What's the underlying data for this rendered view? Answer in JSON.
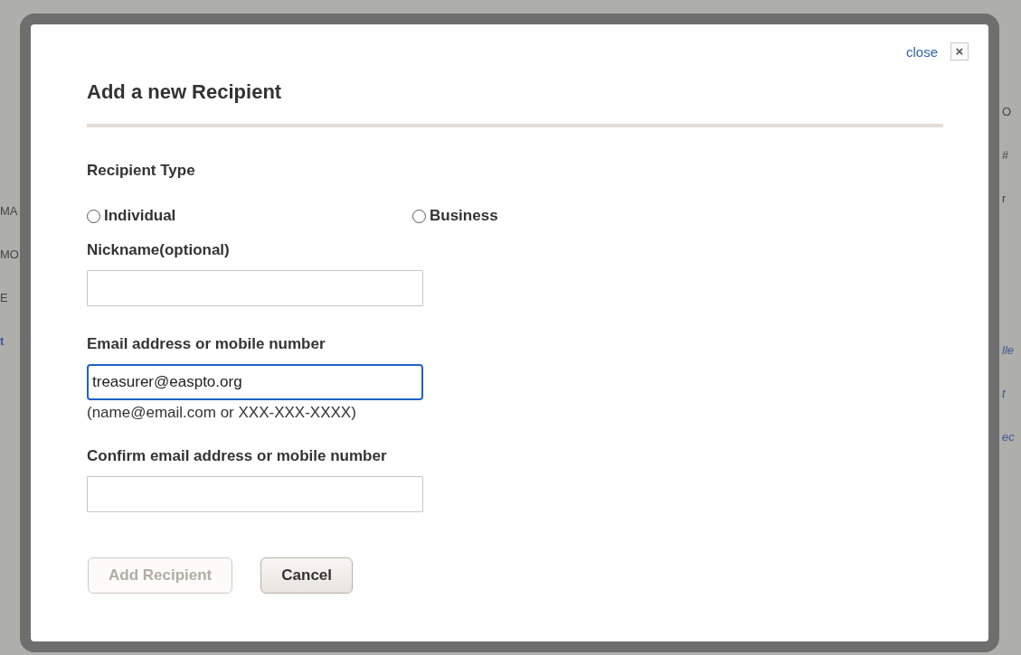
{
  "background": {
    "left_fragments": [
      {
        "text": "MA",
        "kind": "text"
      },
      {
        "text": "MO",
        "kind": "text"
      },
      {
        "text": "E",
        "kind": "text"
      },
      {
        "text": "t",
        "kind": "link"
      }
    ],
    "right_fragments": [
      {
        "text": "O",
        "kind": "text"
      },
      {
        "text": "#",
        "kind": "text"
      },
      {
        "text": "r",
        "kind": "text"
      },
      {
        "text": "lle",
        "kind": "link"
      },
      {
        "text": "t",
        "kind": "link"
      },
      {
        "text": "ec",
        "kind": "link"
      }
    ]
  },
  "dialog": {
    "close_link": "close",
    "close_button": "×",
    "title": "Add a new Recipient",
    "recipient_type": {
      "label": "Recipient Type",
      "options": [
        {
          "label": "Individual",
          "selected": false
        },
        {
          "label": "Business",
          "selected": false
        }
      ]
    },
    "fields": [
      {
        "label": "Nickname(optional)",
        "focused": false
      },
      {
        "label": "Email address or mobile number",
        "value": "treasurer@easpto.org",
        "focused": true,
        "hint": "(name@email.com or XXX-XXX-XXXX)"
      },
      {
        "label": "Confirm email address or mobile number",
        "focused": false
      }
    ],
    "buttons": [
      {
        "label": "Add Recipient",
        "disabled": true
      },
      {
        "label": "Cancel",
        "disabled": false
      }
    ]
  }
}
